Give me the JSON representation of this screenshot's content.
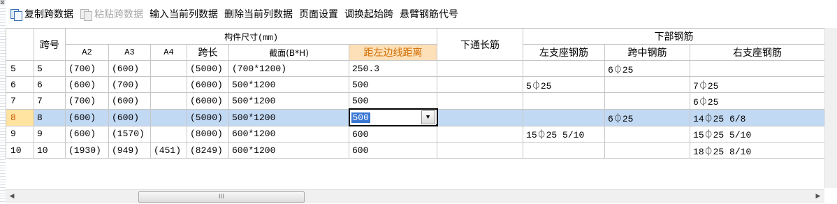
{
  "toolbar": {
    "copy": "复制跨数据",
    "paste": "粘贴跨数据",
    "input_col": "输入当前列数据",
    "delete_col": "删除当前列数据",
    "page_setup": "页面设置",
    "swap_start": "调换起始跨",
    "cantilever": "悬臂钢筋代号"
  },
  "grid": {
    "headers": {
      "span_no": "跨号",
      "size_group": "构件尺寸(mm)",
      "a2": "A2",
      "a3": "A3",
      "a4": "A4",
      "span_len": "跨长",
      "section": "截面(B*H)",
      "left_dist": "距左边线距离",
      "bottom_long": "下通长筋",
      "bottom_group": "下部钢筋",
      "left_seat": "左支座钢筋",
      "mid_span": "跨中钢筋",
      "right_seat": "右支座钢筋"
    },
    "rows": [
      {
        "num": "5",
        "span": "5",
        "a2": "(700)",
        "a3": "(600)",
        "a4": "",
        "len": "(5000)",
        "section": "(700*1200)",
        "dist": "250.3",
        "long": "",
        "left": "",
        "mid": "6⏀25",
        "right": ""
      },
      {
        "num": "6",
        "span": "6",
        "a2": "(600)",
        "a3": "(700)",
        "a4": "",
        "len": "(6000)",
        "section": "500*1200",
        "dist": "500",
        "long": "",
        "left": "5⏀25",
        "mid": "",
        "right": "7⏀25"
      },
      {
        "num": "7",
        "span": "7",
        "a2": "(700)",
        "a3": "(600)",
        "a4": "",
        "len": "(6000)",
        "section": "500*1200",
        "dist": "500",
        "long": "",
        "left": "",
        "mid": "",
        "right": "6⏀25"
      },
      {
        "num": "8",
        "span": "8",
        "a2": "(600)",
        "a3": "(600)",
        "a4": "",
        "len": "(5000)",
        "section": "500*1200",
        "dist": "500",
        "long": "",
        "left": "",
        "mid": "6⏀25",
        "right": "14⏀25 6/8"
      },
      {
        "num": "9",
        "span": "9",
        "a2": "(600)",
        "a3": "(1570)",
        "a4": "",
        "len": "(8000)",
        "section": "600*1200",
        "dist": "600",
        "long": "",
        "left": "15⏀25 5/10",
        "mid": "",
        "right": "15⏀25 5/10"
      },
      {
        "num": "10",
        "span": "10",
        "a2": "(1930)",
        "a3": "(949)",
        "a4": "(451)",
        "len": "(8249)",
        "section": "600*1200",
        "dist": "600",
        "long": "",
        "left": "",
        "mid": "",
        "right": "18⏀25 8/10"
      }
    ],
    "selected_row": 3,
    "editing_value": "500"
  },
  "scroll": {
    "thumb_grip": "III"
  }
}
